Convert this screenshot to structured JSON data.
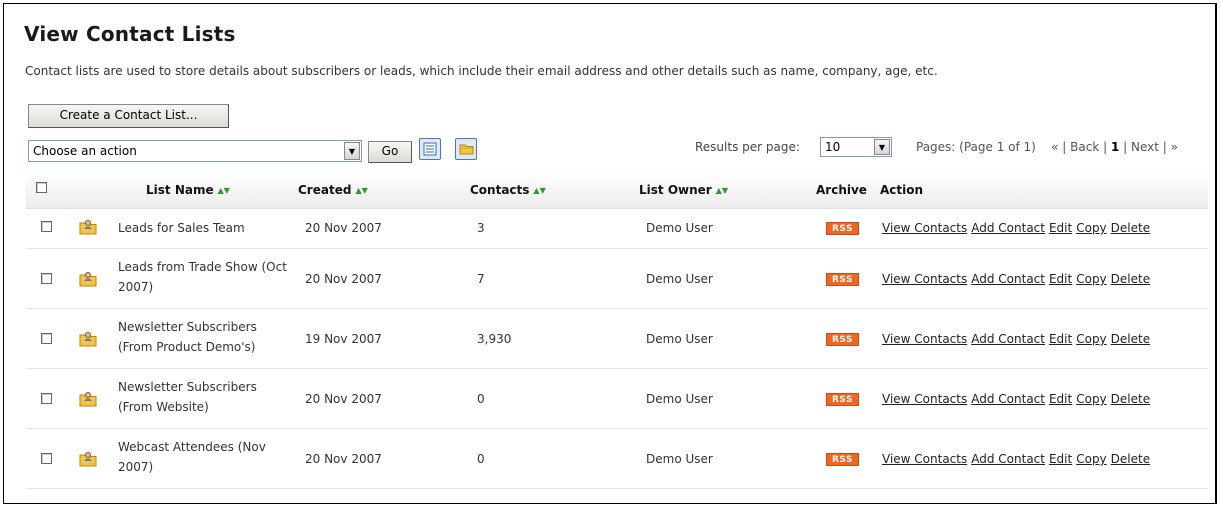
{
  "page": {
    "title": "View Contact Lists",
    "description": "Contact lists are used to store details about subscribers or leads, which include their email address and other details such as name, company, age, etc."
  },
  "toolbar": {
    "create_label": "Create a Contact List...",
    "action_select_value": "Choose an action",
    "go_label": "Go",
    "results_per_page_label": "Results per page:",
    "results_per_page_value": "10",
    "pages_label": "Pages: (Page 1 of 1)",
    "pager": {
      "first": "«",
      "back": "Back",
      "current": "1",
      "next": "Next",
      "last": "»"
    }
  },
  "table": {
    "headers": {
      "list_name": "List Name",
      "created": "Created",
      "contacts": "Contacts",
      "list_owner": "List Owner",
      "archive": "Archive",
      "action": "Action"
    },
    "rss_label": "RSS",
    "action_labels": [
      "View Contacts",
      "Add Contact",
      "Edit",
      "Copy",
      "Delete"
    ],
    "rows": [
      {
        "name": "Leads for Sales Team",
        "created": "20 Nov 2007",
        "contacts": "3",
        "owner": "Demo User"
      },
      {
        "name": "Leads from Trade Show (Oct 2007)",
        "created": "20 Nov 2007",
        "contacts": "7",
        "owner": "Demo User"
      },
      {
        "name": "Newsletter Subscribers (From Product Demo's)",
        "created": "19 Nov 2007",
        "contacts": "3,930",
        "owner": "Demo User"
      },
      {
        "name": "Newsletter Subscribers (From Website)",
        "created": "20 Nov 2007",
        "contacts": "0",
        "owner": "Demo User"
      },
      {
        "name": "Webcast Attendees (Nov 2007)",
        "created": "20 Nov 2007",
        "contacts": "0",
        "owner": "Demo User"
      }
    ]
  },
  "icons": {
    "sort": "sort-arrows-icon",
    "list": "contact-list-icon",
    "view_list": "list-view-icon",
    "view_folder": "folder-view-icon"
  },
  "colors": {
    "rss": "#f26522",
    "sort_arrows": "#2e9a2e"
  }
}
